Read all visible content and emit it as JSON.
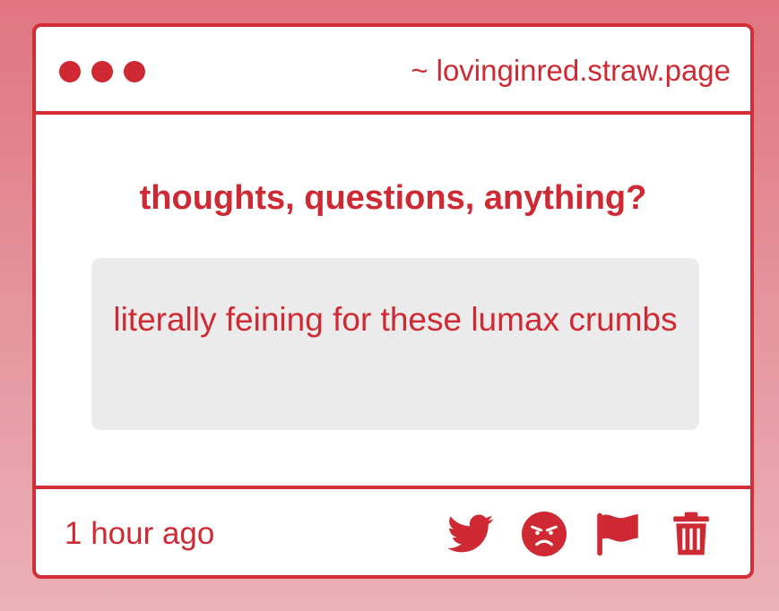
{
  "window": {
    "url": "~ lovinginred.straw.page",
    "control_dots": [
      "dot",
      "dot",
      "dot"
    ]
  },
  "prompt": {
    "heading": "thoughts, questions, anything?"
  },
  "message": {
    "text": "literally feining for these lumax crumbs"
  },
  "footer": {
    "timestamp": "1 hour ago",
    "actions": [
      {
        "name": "twitter-share-button",
        "icon": "twitter-bird-icon"
      },
      {
        "name": "angry-react-button",
        "icon": "angry-face-icon"
      },
      {
        "name": "report-button",
        "icon": "flag-icon"
      },
      {
        "name": "delete-button",
        "icon": "trash-icon"
      }
    ]
  },
  "colors": {
    "accent": "#cf2a33",
    "border": "#d12e38",
    "message_bg": "#ecebeb",
    "page_bg_top": "#e07580",
    "page_bg_bottom": "#ebb1b7"
  }
}
